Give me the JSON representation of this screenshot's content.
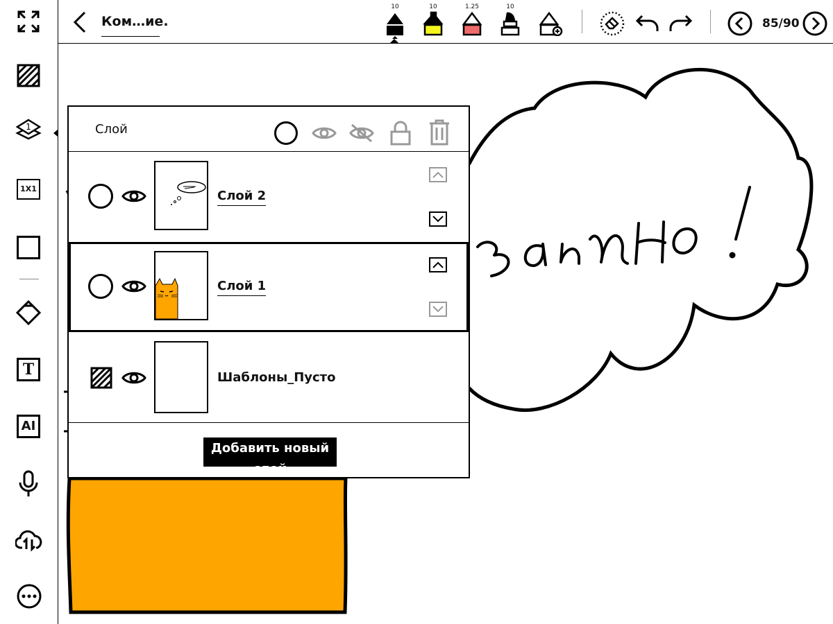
{
  "header": {
    "title": "Ком…ие.",
    "pen_sizes": [
      "10",
      "10",
      "1.25",
      "10"
    ],
    "page_counter": "85/90"
  },
  "sidebar": {
    "items": [
      {
        "name": "fullscreen-icon"
      },
      {
        "name": "template-icon"
      },
      {
        "name": "layers-icon",
        "badge": "1"
      },
      {
        "name": "grid-1x1-icon",
        "label": "1X1"
      },
      {
        "name": "rectangle-icon"
      },
      {
        "name": "eraser-icon"
      },
      {
        "name": "text-icon",
        "label": "T"
      },
      {
        "name": "ai-icon",
        "label": "AI"
      },
      {
        "name": "microphone-icon"
      },
      {
        "name": "cloud-sync-icon"
      },
      {
        "name": "more-icon"
      }
    ]
  },
  "layer_panel": {
    "title": "Слой",
    "layers": [
      {
        "name": "Слой 2",
        "selected": false
      },
      {
        "name": "Слой 1",
        "selected": true
      },
      {
        "name": "Шаблоны_Пусто",
        "selected": false
      }
    ],
    "add_button": "Добавить новый слой"
  },
  "canvas": {
    "handwriting": "заимно!"
  },
  "colors": {
    "pen_yellow": "#f5f51e",
    "pen_red": "#f06a6a",
    "cat_orange": "#ffa500",
    "ink": "#000000",
    "disabled_gray": "#999999"
  }
}
